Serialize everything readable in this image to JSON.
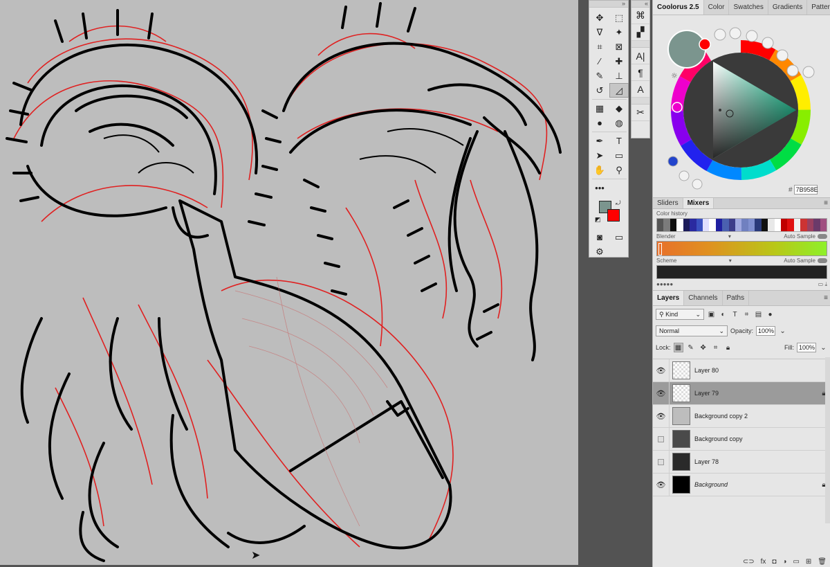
{
  "tools": {
    "items": [
      {
        "name": "move-tool-icon",
        "glyph": "✥"
      },
      {
        "name": "rectangular-marquee-icon",
        "glyph": "⬚"
      },
      {
        "name": "lasso-tool-icon",
        "glyph": "ᐁ"
      },
      {
        "name": "magic-wand-icon",
        "glyph": "✦"
      },
      {
        "name": "crop-tool-icon",
        "glyph": "⌗"
      },
      {
        "name": "frame-tool-icon",
        "glyph": "⊠"
      },
      {
        "name": "eyedropper-icon",
        "glyph": "⁄"
      },
      {
        "name": "healing-brush-icon",
        "glyph": "✚"
      },
      {
        "name": "brush-tool-icon",
        "glyph": "✎"
      },
      {
        "name": "clone-stamp-icon",
        "glyph": "⊥"
      },
      {
        "name": "history-brush-icon",
        "glyph": "↺"
      },
      {
        "name": "eraser-tool-icon",
        "glyph": "◿"
      },
      {
        "name": "gradient-tool-icon",
        "glyph": "▦"
      },
      {
        "name": "blur-tool-icon",
        "glyph": "◆"
      },
      {
        "name": "dodge-tool-icon",
        "glyph": "●"
      },
      {
        "name": "sponge-tool-icon",
        "glyph": "◍"
      },
      {
        "name": "pen-tool-icon",
        "glyph": "✒"
      },
      {
        "name": "type-tool-icon",
        "glyph": "T"
      },
      {
        "name": "path-selection-icon",
        "glyph": "➤"
      },
      {
        "name": "rectangle-tool-icon",
        "glyph": "▭"
      },
      {
        "name": "hand-tool-icon",
        "glyph": "✋"
      },
      {
        "name": "zoom-tool-icon",
        "glyph": "⚲"
      },
      {
        "name": "more-tools-icon",
        "glyph": "•••"
      }
    ],
    "foreground_color": "#7B958E",
    "background_color": "#FF0000"
  },
  "dock": {
    "items": [
      {
        "name": "brush-settings-icon",
        "glyph": "⌘"
      },
      {
        "name": "clone-source-icon",
        "glyph": "▞"
      },
      {
        "name": "character-panel-icon",
        "glyph": "A|"
      },
      {
        "name": "paragraph-panel-icon",
        "glyph": "¶"
      },
      {
        "name": "glyphs-panel-icon",
        "glyph": "A"
      },
      {
        "name": "tool-presets-icon",
        "glyph": "✂"
      }
    ]
  },
  "coolorus": {
    "tabs": [
      "Coolorus 2.5",
      "Color",
      "Swatches",
      "Gradients",
      "Patterns"
    ],
    "active_tab": "Coolorus 2.5",
    "hex_prefix": "#",
    "hex_value": "7B958E",
    "current_color": "#7B958E",
    "secondary_color": "#FF0000"
  },
  "mixers": {
    "tabs": [
      "Sliders",
      "Mixers"
    ],
    "active_tab": "Mixers",
    "history_label": "Color history",
    "blender_label": "Blender",
    "auto_sample_label": "Auto Sample",
    "scheme_label": "Scheme",
    "history_colors": [
      "#555555",
      "#7b7b7b",
      "#111111",
      "#ffffff",
      "#1c1c5a",
      "#2a2aa0",
      "#3a50c0",
      "#e0e0ff",
      "#ffffff",
      "#2020a0",
      "#4a60b0",
      "#3c3c8a",
      "#a0a8e0",
      "#7080c0",
      "#8090d0",
      "#2a3a7a",
      "#101010",
      "#e8e8e8",
      "#ffffff",
      "#c00000",
      "#e01010",
      "#f0f0f0",
      "#cc3333",
      "#9a4060",
      "#6a3a6a",
      "#a05080"
    ]
  },
  "layers": {
    "tabs": [
      "Layers",
      "Channels",
      "Paths"
    ],
    "active_tab": "Layers",
    "filter_label": "Kind",
    "blend_mode": "Normal",
    "opacity_label": "Opacity:",
    "opacity_value": "100%",
    "lock_label": "Lock:",
    "fill_label": "Fill:",
    "fill_value": "100%",
    "items": [
      {
        "name": "Layer 80",
        "visible": true,
        "locked": false,
        "selected": false,
        "italic": false,
        "thumb": "#eeeeee"
      },
      {
        "name": "Layer 79",
        "visible": true,
        "locked": true,
        "selected": true,
        "italic": false,
        "thumb": "#f4dede"
      },
      {
        "name": "Background copy 2",
        "visible": true,
        "locked": false,
        "selected": false,
        "italic": false,
        "thumb": "#bdbdbd"
      },
      {
        "name": "Background copy",
        "visible": false,
        "locked": false,
        "selected": false,
        "italic": false,
        "thumb": "#4a4a4a"
      },
      {
        "name": "Layer 78",
        "visible": false,
        "locked": false,
        "selected": false,
        "italic": false,
        "thumb": "#2a2a2a"
      },
      {
        "name": "Background",
        "visible": true,
        "locked": true,
        "selected": false,
        "italic": true,
        "thumb": "#000000"
      }
    ]
  }
}
